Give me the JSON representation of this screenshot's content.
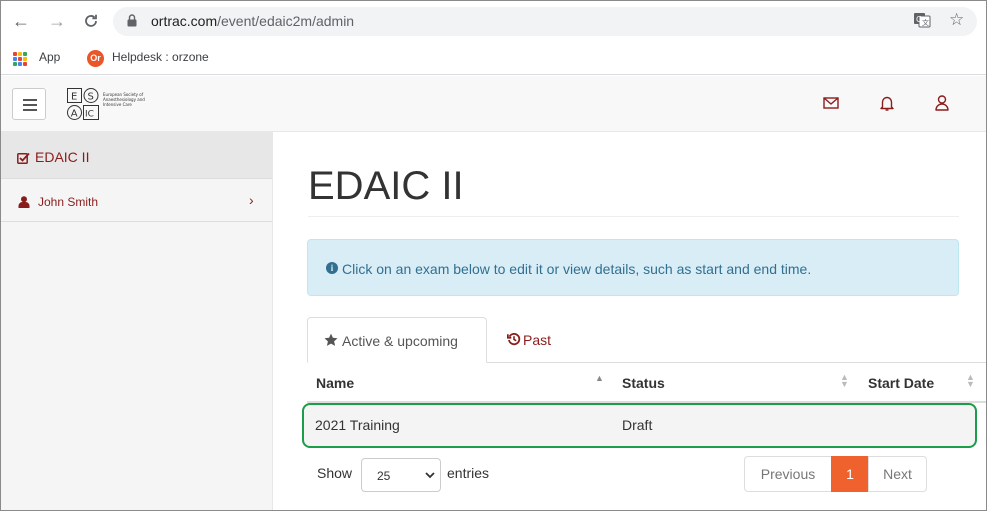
{
  "browser": {
    "url_host": "ortrac.com",
    "url_path": "/event/edaic2m/admin",
    "bookmarks": [
      {
        "label": "App",
        "icon": "apps-grid-icon"
      },
      {
        "label": "Helpdesk : orzone",
        "icon": "orzone-icon",
        "icon_text": "Or"
      }
    ]
  },
  "header": {
    "logo_letters": [
      "E",
      "S",
      "A",
      "IC"
    ],
    "logo_caption": [
      "European Society of",
      "Anaesthesiology and",
      "Intensive Care"
    ]
  },
  "sidebar": {
    "items": [
      {
        "label": "EDAIC II",
        "icon": "checkbox-icon",
        "active": true
      },
      {
        "label": "John Smith",
        "icon": "user-icon",
        "active": false
      }
    ]
  },
  "main": {
    "title": "EDAIC II",
    "alert": "Click on an exam below to edit it or view details, such as start and end time.",
    "tabs": [
      {
        "label": "Active & upcoming",
        "icon": "star-icon",
        "active": true
      },
      {
        "label": "Past",
        "icon": "history-icon",
        "active": false
      }
    ],
    "table": {
      "columns": [
        "Name",
        "Status",
        "Start Date"
      ],
      "rows": [
        {
          "name": "2021 Training",
          "status": "Draft",
          "start_date": ""
        }
      ]
    },
    "length_menu": {
      "show_label": "Show",
      "value": "25",
      "entries_label": "entries"
    },
    "pagination": {
      "previous": "Previous",
      "current": "1",
      "next": "Next"
    }
  },
  "colors": {
    "accent": "#f0622d",
    "link": "#8b1c1c",
    "alert_bg": "#d9edf7",
    "alert_text": "#31708f",
    "highlight_border": "#1a9e4a"
  }
}
